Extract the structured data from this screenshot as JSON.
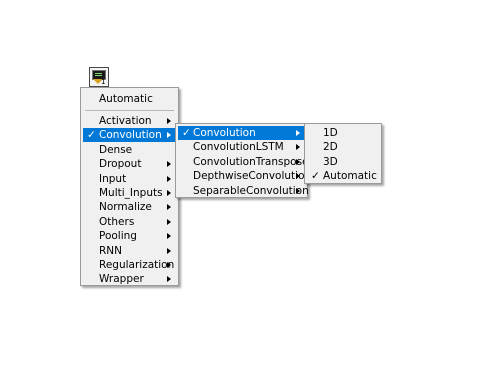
{
  "node": {
    "badge": "1"
  },
  "menu1": {
    "first": "Automatic",
    "items": [
      {
        "label": "Activation",
        "submenu": true
      },
      {
        "label": "Convolution",
        "submenu": true,
        "checked": true,
        "highlighted": true
      },
      {
        "label": "Dense",
        "submenu": false
      },
      {
        "label": "Dropout",
        "submenu": true
      },
      {
        "label": "Input",
        "submenu": true
      },
      {
        "label": "Multi_Inputs",
        "submenu": true
      },
      {
        "label": "Normalize",
        "submenu": true
      },
      {
        "label": "Others",
        "submenu": true
      },
      {
        "label": "Pooling",
        "submenu": true
      },
      {
        "label": "RNN",
        "submenu": true
      },
      {
        "label": "Regularization",
        "submenu": true
      },
      {
        "label": "Wrapper",
        "submenu": true
      }
    ]
  },
  "menu2": {
    "items": [
      {
        "label": "Convolution",
        "submenu": true,
        "checked": true,
        "highlighted": true
      },
      {
        "label": "ConvolutionLSTM",
        "submenu": true
      },
      {
        "label": "ConvolutionTranspose",
        "submenu": true
      },
      {
        "label": "DepthwiseConvolution",
        "submenu": true
      },
      {
        "label": "SeparableConvolution",
        "submenu": true
      }
    ]
  },
  "menu3": {
    "items": [
      {
        "label": "1D"
      },
      {
        "label": "2D"
      },
      {
        "label": "3D"
      },
      {
        "label": "Automatic",
        "checked": true
      }
    ]
  },
  "glyphs": {
    "check": "✓"
  },
  "colors": {
    "highlight": "#0078d7",
    "menu_bg": "#f0f0f0"
  }
}
